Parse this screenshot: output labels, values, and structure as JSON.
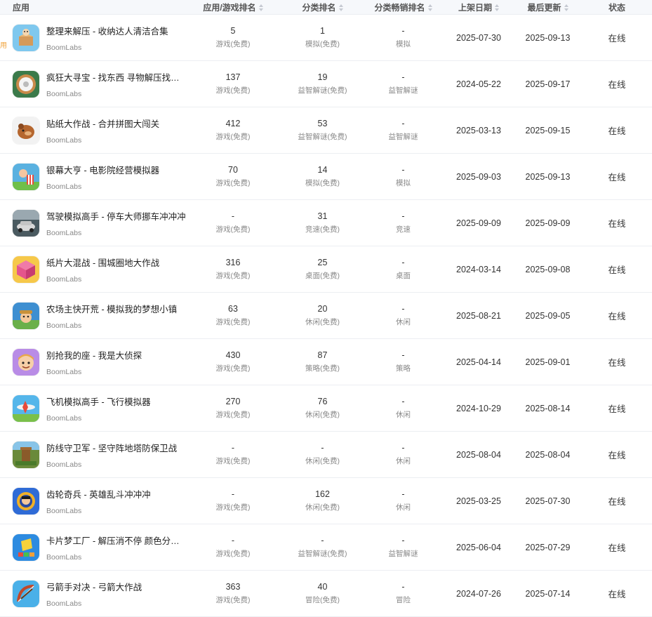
{
  "header": {
    "app": "应用",
    "rank": "应用/游戏排名",
    "category_rank": "分类排名",
    "category_gross": "分类畅销排名",
    "release": "上架日期",
    "updated": "最后更新",
    "status": "状态"
  },
  "edge_tag": "用",
  "rows": [
    {
      "name": "整理来解压 - 收纳达人清洁合集",
      "dev": "BoomLabs",
      "rank": "5",
      "rank_sub": "游戏(免费)",
      "cat_rank": "1",
      "cat_sub": "模拟(免费)",
      "gross": "-",
      "gross_sub": "模拟",
      "release": "2025-07-30",
      "updated": "2025-09-13",
      "status": "在线",
      "icon": "box-icon",
      "color": "#7fc8ee"
    },
    {
      "name": "疯狂大寻宝 - 找东西 寻物解压找…",
      "dev": "BoomLabs",
      "rank": "137",
      "rank_sub": "游戏(免费)",
      "cat_rank": "19",
      "cat_sub": "益智解谜(免费)",
      "gross": "-",
      "gross_sub": "益智解谜",
      "release": "2024-05-22",
      "updated": "2025-09-17",
      "status": "在线",
      "icon": "toilet-paper-icon",
      "color": "#3b7a4a"
    },
    {
      "name": "贴纸大作战 - 合并拼图大闯关",
      "dev": "BoomLabs",
      "rank": "412",
      "rank_sub": "游戏(免费)",
      "cat_rank": "53",
      "cat_sub": "益智解谜(免费)",
      "gross": "-",
      "gross_sub": "益智解谜",
      "release": "2025-03-13",
      "updated": "2025-09-15",
      "status": "在线",
      "icon": "bear-icon",
      "color": "#f2f2f2"
    },
    {
      "name": "银幕大亨 - 电影院经营模拟器",
      "dev": "BoomLabs",
      "rank": "70",
      "rank_sub": "游戏(免费)",
      "cat_rank": "14",
      "cat_sub": "模拟(免费)",
      "gross": "-",
      "gross_sub": "模拟",
      "release": "2025-09-03",
      "updated": "2025-09-13",
      "status": "在线",
      "icon": "popcorn-icon",
      "color": "#5ab1e0"
    },
    {
      "name": "驾驶模拟高手 - 停车大师挪车冲冲冲",
      "dev": "BoomLabs",
      "rank": "-",
      "rank_sub": "游戏(免费)",
      "cat_rank": "31",
      "cat_sub": "竞速(免费)",
      "gross": "-",
      "gross_sub": "竞速",
      "release": "2025-09-09",
      "updated": "2025-09-09",
      "status": "在线",
      "icon": "car-icon",
      "color": "#4a5a60"
    },
    {
      "name": "纸片大混战 - 围城圈地大作战",
      "dev": "BoomLabs",
      "rank": "316",
      "rank_sub": "游戏(免费)",
      "cat_rank": "25",
      "cat_sub": "桌面(免费)",
      "gross": "-",
      "gross_sub": "桌面",
      "release": "2024-03-14",
      "updated": "2025-09-08",
      "status": "在线",
      "icon": "cube-icon",
      "color": "#f6c84a"
    },
    {
      "name": "农场主快开荒 - 模拟我的梦想小镇",
      "dev": "BoomLabs",
      "rank": "63",
      "rank_sub": "游戏(免费)",
      "cat_rank": "20",
      "cat_sub": "休闲(免费)",
      "gross": "-",
      "gross_sub": "休闲",
      "release": "2025-08-21",
      "updated": "2025-09-05",
      "status": "在线",
      "icon": "farmer-icon",
      "color": "#3e8fd1"
    },
    {
      "name": "别抢我的座 - 我是大侦探",
      "dev": "BoomLabs",
      "rank": "430",
      "rank_sub": "游戏(免费)",
      "cat_rank": "87",
      "cat_sub": "策略(免费)",
      "gross": "-",
      "gross_sub": "策略",
      "release": "2025-04-14",
      "updated": "2025-09-01",
      "status": "在线",
      "icon": "face-icon",
      "color": "#b98ce6"
    },
    {
      "name": "飞机模拟高手 - 飞行模拟器",
      "dev": "BoomLabs",
      "rank": "270",
      "rank_sub": "游戏(免费)",
      "cat_rank": "76",
      "cat_sub": "休闲(免费)",
      "gross": "-",
      "gross_sub": "休闲",
      "release": "2024-10-29",
      "updated": "2025-08-14",
      "status": "在线",
      "icon": "plane-icon",
      "color": "#55b6ea"
    },
    {
      "name": "防线守卫军 - 坚守阵地塔防保卫战",
      "dev": "BoomLabs",
      "rank": "-",
      "rank_sub": "游戏(免费)",
      "cat_rank": "-",
      "cat_sub": "休闲(免费)",
      "gross": "-",
      "gross_sub": "休闲",
      "release": "2025-08-04",
      "updated": "2025-08-04",
      "status": "在线",
      "icon": "tower-icon",
      "color": "#6a8a3a"
    },
    {
      "name": "齿轮奇兵 - 英雄乱斗冲冲冲",
      "dev": "BoomLabs",
      "rank": "-",
      "rank_sub": "游戏(免费)",
      "cat_rank": "162",
      "cat_sub": "休闲(免费)",
      "gross": "-",
      "gross_sub": "休闲",
      "release": "2025-03-25",
      "updated": "2025-07-30",
      "status": "在线",
      "icon": "gear-icon",
      "color": "#2f6bd6"
    },
    {
      "name": "卡片梦工厂 - 解压消不停 颜色分…",
      "dev": "BoomLabs",
      "rank": "-",
      "rank_sub": "游戏(免费)",
      "cat_rank": "-",
      "cat_sub": "益智解谜(免费)",
      "gross": "-",
      "gross_sub": "益智解谜",
      "release": "2025-06-04",
      "updated": "2025-07-29",
      "status": "在线",
      "icon": "card-stack-icon",
      "color": "#2d8be0"
    },
    {
      "name": "弓箭手对决 - 弓箭大作战",
      "dev": "BoomLabs",
      "rank": "363",
      "rank_sub": "游戏(免费)",
      "cat_rank": "40",
      "cat_sub": "冒险(免费)",
      "gross": "-",
      "gross_sub": "冒险",
      "release": "2024-07-26",
      "updated": "2025-07-14",
      "status": "在线",
      "icon": "bow-icon",
      "color": "#4ab0e8"
    }
  ]
}
